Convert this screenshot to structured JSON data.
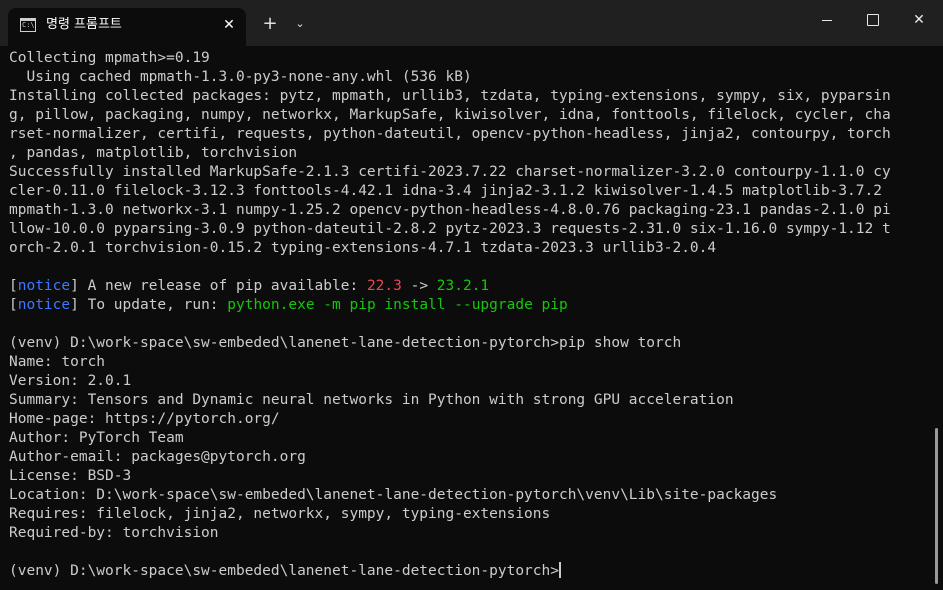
{
  "window": {
    "tab_title": "명령 프롬프트",
    "tab_icon": "cmd-icon",
    "close_tab": "✕",
    "new_tab": "+",
    "dropdown": "⌄",
    "minimize": "",
    "maximize": "",
    "close": "✕"
  },
  "terminal": {
    "lines": [
      [
        {
          "t": "Collecting mpmath>=0.19",
          "c": ""
        }
      ],
      [
        {
          "t": "  Using cached mpmath-1.3.0-py3-none-any.whl (536 kB)",
          "c": ""
        }
      ],
      [
        {
          "t": "Installing collected packages: pytz, mpmath, urllib3, tzdata, typing-extensions, sympy, six, pyparsin",
          "c": ""
        }
      ],
      [
        {
          "t": "g, pillow, packaging, numpy, networkx, MarkupSafe, kiwisolver, idna, fonttools, filelock, cycler, cha",
          "c": ""
        }
      ],
      [
        {
          "t": "rset-normalizer, certifi, requests, python-dateutil, opencv-python-headless, jinja2, contourpy, torch",
          "c": ""
        }
      ],
      [
        {
          "t": ", pandas, matplotlib, torchvision",
          "c": ""
        }
      ],
      [
        {
          "t": "Successfully installed MarkupSafe-2.1.3 certifi-2023.7.22 charset-normalizer-3.2.0 contourpy-1.1.0 cy",
          "c": ""
        }
      ],
      [
        {
          "t": "cler-0.11.0 filelock-3.12.3 fonttools-4.42.1 idna-3.4 jinja2-3.1.2 kiwisolver-1.4.5 matplotlib-3.7.2",
          "c": ""
        }
      ],
      [
        {
          "t": "mpmath-1.3.0 networkx-3.1 numpy-1.25.2 opencv-python-headless-4.8.0.76 packaging-23.1 pandas-2.1.0 pi",
          "c": ""
        }
      ],
      [
        {
          "t": "llow-10.0.0 pyparsing-3.0.9 python-dateutil-2.8.2 pytz-2023.3 requests-2.31.0 six-1.16.0 sympy-1.12 t",
          "c": ""
        }
      ],
      [
        {
          "t": "orch-2.0.1 torchvision-0.15.2 typing-extensions-4.7.1 tzdata-2023.3 urllib3-2.0.4",
          "c": ""
        }
      ],
      [
        {
          "t": "",
          "c": ""
        }
      ],
      [
        {
          "t": "[",
          "c": ""
        },
        {
          "t": "notice",
          "c": "c-notice"
        },
        {
          "t": "] A new release of pip available: ",
          "c": ""
        },
        {
          "t": "22.3",
          "c": "c-red"
        },
        {
          "t": " -> ",
          "c": ""
        },
        {
          "t": "23.2.1",
          "c": "c-green"
        }
      ],
      [
        {
          "t": "[",
          "c": ""
        },
        {
          "t": "notice",
          "c": "c-notice"
        },
        {
          "t": "] To update, run: ",
          "c": ""
        },
        {
          "t": "python.exe -m pip install --upgrade pip",
          "c": "c-green"
        }
      ],
      [
        {
          "t": "",
          "c": ""
        }
      ],
      [
        {
          "t": "(venv) D:\\work-space\\sw-embeded\\lanenet-lane-detection-pytorch>pip show torch",
          "c": ""
        }
      ],
      [
        {
          "t": "Name: torch",
          "c": ""
        }
      ],
      [
        {
          "t": "Version: 2.0.1",
          "c": ""
        }
      ],
      [
        {
          "t": "Summary: Tensors and Dynamic neural networks in Python with strong GPU acceleration",
          "c": ""
        }
      ],
      [
        {
          "t": "Home-page: https://pytorch.org/",
          "c": ""
        }
      ],
      [
        {
          "t": "Author: PyTorch Team",
          "c": ""
        }
      ],
      [
        {
          "t": "Author-email: packages@pytorch.org",
          "c": ""
        }
      ],
      [
        {
          "t": "License: BSD-3",
          "c": ""
        }
      ],
      [
        {
          "t": "Location: D:\\work-space\\sw-embeded\\lanenet-lane-detection-pytorch\\venv\\Lib\\site-packages",
          "c": ""
        }
      ],
      [
        {
          "t": "Requires: filelock, jinja2, networkx, sympy, typing-extensions",
          "c": ""
        }
      ],
      [
        {
          "t": "Required-by: torchvision",
          "c": ""
        }
      ],
      [
        {
          "t": "",
          "c": ""
        }
      ]
    ],
    "prompt": "(venv) D:\\work-space\\sw-embeded\\lanenet-lane-detection-pytorch>"
  }
}
